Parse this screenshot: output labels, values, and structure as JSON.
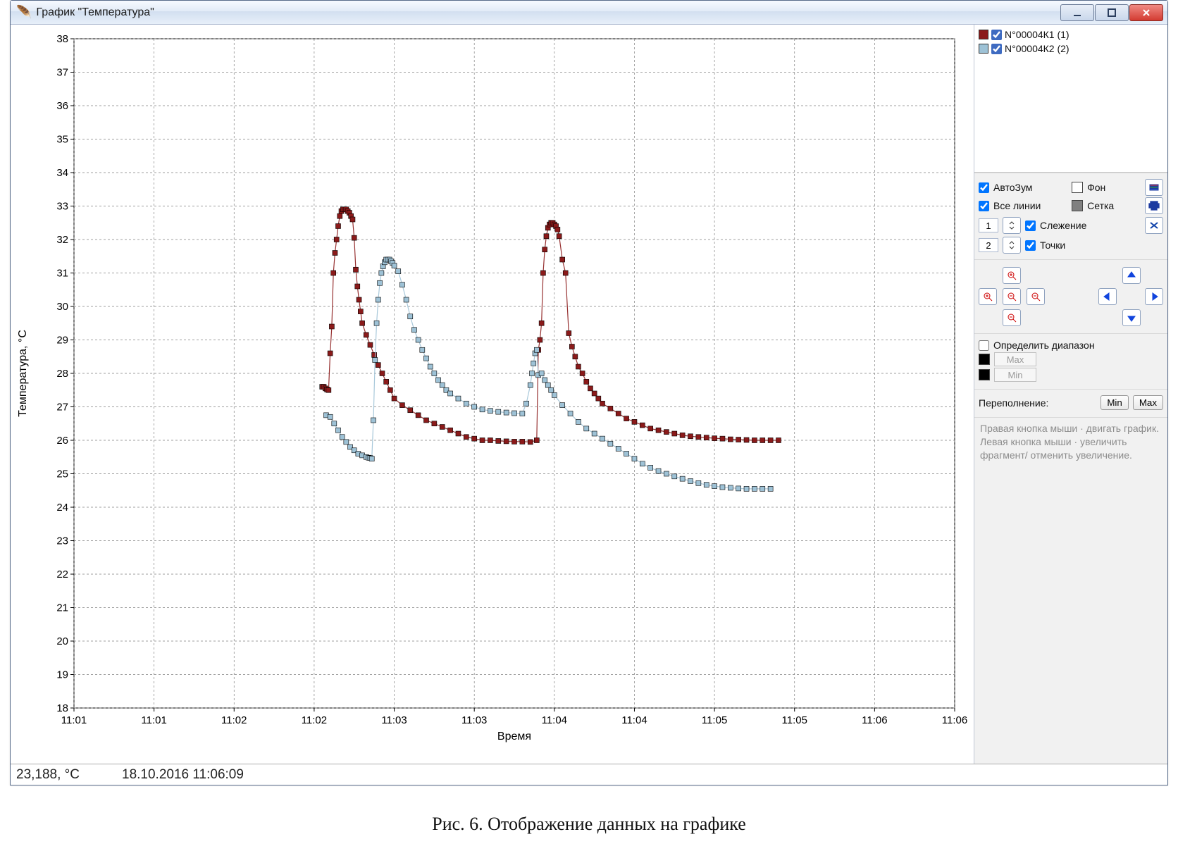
{
  "window": {
    "title": "График \"Температура\""
  },
  "chart_data": {
    "type": "scatter",
    "title": "",
    "xlabel": "Время",
    "ylabel": "Температура, °C",
    "ylim": [
      18,
      38
    ],
    "y_ticks": [
      18,
      19,
      20,
      21,
      22,
      23,
      24,
      25,
      26,
      27,
      28,
      29,
      30,
      31,
      32,
      33,
      34,
      35,
      36,
      37,
      38
    ],
    "x_tick_labels": [
      "11:01",
      "11:01",
      "11:02",
      "11:02",
      "11:03",
      "11:03",
      "11:04",
      "11:04",
      "11:05",
      "11:05",
      "11:06",
      "11:06"
    ],
    "series": [
      {
        "name": "N°00004К1 (1)",
        "color": "#8b1a1a",
        "points": [
          [
            3.1,
            27.6
          ],
          [
            3.12,
            27.6
          ],
          [
            3.14,
            27.55
          ],
          [
            3.16,
            27.52
          ],
          [
            3.18,
            27.5
          ],
          [
            3.2,
            28.6
          ],
          [
            3.22,
            29.4
          ],
          [
            3.24,
            31.0
          ],
          [
            3.26,
            31.6
          ],
          [
            3.28,
            32.0
          ],
          [
            3.3,
            32.4
          ],
          [
            3.32,
            32.7
          ],
          [
            3.34,
            32.85
          ],
          [
            3.36,
            32.9
          ],
          [
            3.38,
            32.9
          ],
          [
            3.4,
            32.9
          ],
          [
            3.42,
            32.85
          ],
          [
            3.44,
            32.8
          ],
          [
            3.46,
            32.7
          ],
          [
            3.48,
            32.6
          ],
          [
            3.5,
            32.05
          ],
          [
            3.52,
            31.1
          ],
          [
            3.54,
            30.6
          ],
          [
            3.56,
            30.2
          ],
          [
            3.58,
            29.85
          ],
          [
            3.6,
            29.5
          ],
          [
            3.65,
            29.15
          ],
          [
            3.7,
            28.85
          ],
          [
            3.75,
            28.55
          ],
          [
            3.8,
            28.25
          ],
          [
            3.85,
            28.0
          ],
          [
            3.9,
            27.75
          ],
          [
            3.95,
            27.5
          ],
          [
            4.0,
            27.25
          ],
          [
            4.1,
            27.05
          ],
          [
            4.2,
            26.9
          ],
          [
            4.3,
            26.75
          ],
          [
            4.4,
            26.6
          ],
          [
            4.5,
            26.5
          ],
          [
            4.6,
            26.4
          ],
          [
            4.7,
            26.3
          ],
          [
            4.8,
            26.2
          ],
          [
            4.9,
            26.1
          ],
          [
            5.0,
            26.05
          ],
          [
            5.1,
            26.0
          ],
          [
            5.2,
            26.0
          ],
          [
            5.3,
            25.98
          ],
          [
            5.4,
            25.97
          ],
          [
            5.5,
            25.96
          ],
          [
            5.6,
            25.96
          ],
          [
            5.7,
            25.95
          ],
          [
            5.78,
            26.0
          ],
          [
            5.8,
            28.7
          ],
          [
            5.82,
            29.0
          ],
          [
            5.84,
            29.5
          ],
          [
            5.86,
            31.0
          ],
          [
            5.88,
            31.7
          ],
          [
            5.9,
            32.1
          ],
          [
            5.92,
            32.35
          ],
          [
            5.94,
            32.45
          ],
          [
            5.96,
            32.5
          ],
          [
            5.98,
            32.5
          ],
          [
            6.0,
            32.45
          ],
          [
            6.02,
            32.4
          ],
          [
            6.04,
            32.3
          ],
          [
            6.06,
            32.1
          ],
          [
            6.1,
            31.4
          ],
          [
            6.14,
            31.0
          ],
          [
            6.18,
            29.2
          ],
          [
            6.22,
            28.8
          ],
          [
            6.26,
            28.5
          ],
          [
            6.3,
            28.2
          ],
          [
            6.35,
            28.0
          ],
          [
            6.4,
            27.75
          ],
          [
            6.45,
            27.55
          ],
          [
            6.5,
            27.4
          ],
          [
            6.55,
            27.25
          ],
          [
            6.6,
            27.1
          ],
          [
            6.7,
            26.95
          ],
          [
            6.8,
            26.8
          ],
          [
            6.9,
            26.65
          ],
          [
            7.0,
            26.55
          ],
          [
            7.1,
            26.45
          ],
          [
            7.2,
            26.35
          ],
          [
            7.3,
            26.3
          ],
          [
            7.4,
            26.25
          ],
          [
            7.5,
            26.2
          ],
          [
            7.6,
            26.15
          ],
          [
            7.7,
            26.12
          ],
          [
            7.8,
            26.1
          ],
          [
            7.9,
            26.08
          ],
          [
            8.0,
            26.06
          ],
          [
            8.1,
            26.05
          ],
          [
            8.2,
            26.03
          ],
          [
            8.3,
            26.02
          ],
          [
            8.4,
            26.01
          ],
          [
            8.5,
            26.0
          ],
          [
            8.6,
            26.0
          ],
          [
            8.7,
            26.0
          ],
          [
            8.8,
            26.0
          ]
        ]
      },
      {
        "name": "N°00004К2 (2)",
        "color": "#9ec2d6",
        "points": [
          [
            3.15,
            26.75
          ],
          [
            3.2,
            26.7
          ],
          [
            3.25,
            26.5
          ],
          [
            3.3,
            26.3
          ],
          [
            3.35,
            26.1
          ],
          [
            3.4,
            25.95
          ],
          [
            3.45,
            25.8
          ],
          [
            3.5,
            25.7
          ],
          [
            3.55,
            25.6
          ],
          [
            3.6,
            25.55
          ],
          [
            3.65,
            25.5
          ],
          [
            3.68,
            25.48
          ],
          [
            3.7,
            25.47
          ],
          [
            3.72,
            25.45
          ],
          [
            3.74,
            26.6
          ],
          [
            3.76,
            28.4
          ],
          [
            3.78,
            29.5
          ],
          [
            3.8,
            30.2
          ],
          [
            3.82,
            30.7
          ],
          [
            3.84,
            31.0
          ],
          [
            3.86,
            31.2
          ],
          [
            3.88,
            31.32
          ],
          [
            3.9,
            31.4
          ],
          [
            3.92,
            31.4
          ],
          [
            3.94,
            31.4
          ],
          [
            3.96,
            31.35
          ],
          [
            3.98,
            31.3
          ],
          [
            4.0,
            31.22
          ],
          [
            4.05,
            31.05
          ],
          [
            4.1,
            30.65
          ],
          [
            4.15,
            30.2
          ],
          [
            4.2,
            29.7
          ],
          [
            4.25,
            29.3
          ],
          [
            4.3,
            29.0
          ],
          [
            4.35,
            28.7
          ],
          [
            4.4,
            28.45
          ],
          [
            4.45,
            28.2
          ],
          [
            4.5,
            28.0
          ],
          [
            4.55,
            27.8
          ],
          [
            4.6,
            27.65
          ],
          [
            4.65,
            27.5
          ],
          [
            4.7,
            27.4
          ],
          [
            4.8,
            27.25
          ],
          [
            4.9,
            27.1
          ],
          [
            5.0,
            27.0
          ],
          [
            5.1,
            26.92
          ],
          [
            5.2,
            26.88
          ],
          [
            5.3,
            26.85
          ],
          [
            5.4,
            26.83
          ],
          [
            5.5,
            26.81
          ],
          [
            5.6,
            26.8
          ],
          [
            5.65,
            27.1
          ],
          [
            5.7,
            27.65
          ],
          [
            5.72,
            28.0
          ],
          [
            5.74,
            28.3
          ],
          [
            5.76,
            28.6
          ],
          [
            5.78,
            28.7
          ],
          [
            5.8,
            27.95
          ],
          [
            5.84,
            28.0
          ],
          [
            5.88,
            27.8
          ],
          [
            5.92,
            27.65
          ],
          [
            5.96,
            27.5
          ],
          [
            6.0,
            27.35
          ],
          [
            6.1,
            27.05
          ],
          [
            6.2,
            26.8
          ],
          [
            6.3,
            26.55
          ],
          [
            6.4,
            26.35
          ],
          [
            6.5,
            26.2
          ],
          [
            6.6,
            26.05
          ],
          [
            6.7,
            25.9
          ],
          [
            6.8,
            25.75
          ],
          [
            6.9,
            25.6
          ],
          [
            7.0,
            25.45
          ],
          [
            7.1,
            25.3
          ],
          [
            7.2,
            25.18
          ],
          [
            7.3,
            25.08
          ],
          [
            7.4,
            25.0
          ],
          [
            7.5,
            24.92
          ],
          [
            7.6,
            24.85
          ],
          [
            7.7,
            24.78
          ],
          [
            7.8,
            24.72
          ],
          [
            7.9,
            24.67
          ],
          [
            8.0,
            24.63
          ],
          [
            8.1,
            24.6
          ],
          [
            8.2,
            24.58
          ],
          [
            8.3,
            24.56
          ],
          [
            8.4,
            24.55
          ],
          [
            8.5,
            24.55
          ],
          [
            8.6,
            24.55
          ],
          [
            8.7,
            24.55
          ]
        ]
      }
    ]
  },
  "legend": {
    "items": [
      {
        "color": "#8b1a1a",
        "checked": true,
        "label": "N°00004К1 (1)"
      },
      {
        "color": "#9ec2d6",
        "checked": true,
        "label": "N°00004К2 (2)"
      }
    ]
  },
  "controls": {
    "autozoom_label": "АвтоЗум",
    "all_lines_label": "Все линии",
    "bg_label": "Фон",
    "grid_label": "Сетка",
    "bg_color": "#ffffff",
    "grid_color": "#808080",
    "track_idx": "1",
    "points_idx": "2",
    "track_label": "Слежение",
    "points_label": "Точки",
    "range_label": "Определить диапазон",
    "max_label": "Max",
    "min_label": "Min",
    "overflow_label": "Переполнение:",
    "overflow_min": "Min",
    "overflow_max": "Max",
    "hint": "Правая кнопка мыши · двигать график.\nЛевая кнопка мыши · увеличить фрагмент/ отменить увеличение."
  },
  "status": {
    "value": "23,188, °C",
    "datetime": "18.10.2016 11:06:09"
  },
  "caption": "Рис. 6. Отображение данных на графике"
}
